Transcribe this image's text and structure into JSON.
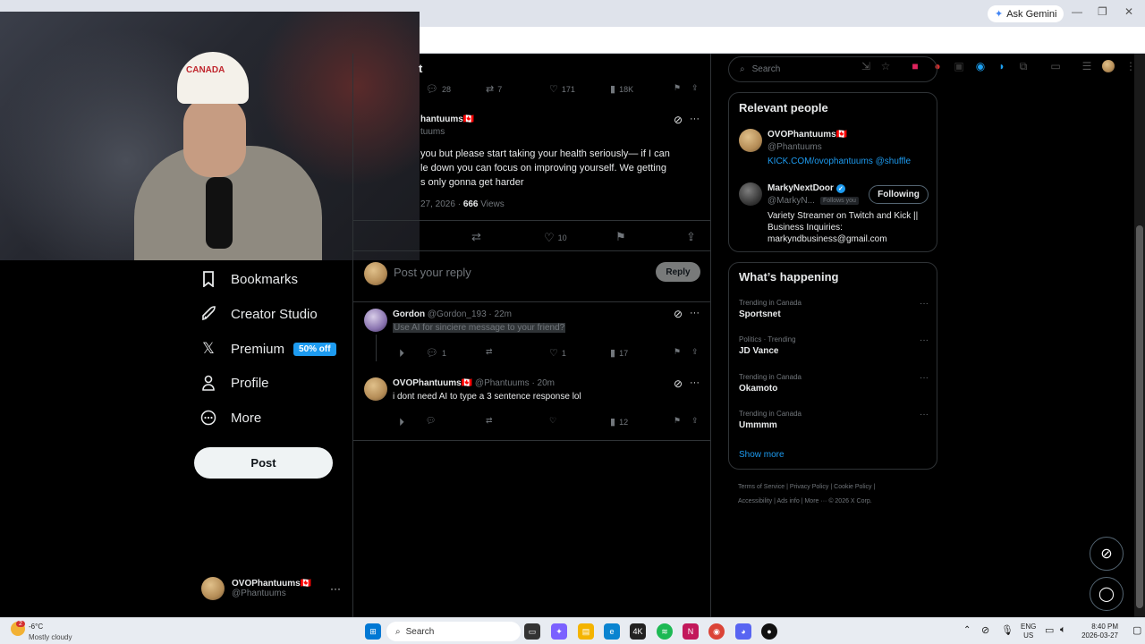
{
  "browser": {
    "ask_gemini": "Ask Gemini"
  },
  "webcam": {
    "hat_text": "CANADA"
  },
  "nav": {
    "bookmarks": "Bookmarks",
    "creator_studio": "Creator Studio",
    "premium": "Premium",
    "premium_badge": "50% off",
    "profile": "Profile",
    "more": "More",
    "post_button": "Post"
  },
  "account": {
    "name": "OVOPhantuums🇨🇦",
    "handle": "@Phantuums"
  },
  "prev_tweet": {
    "title_fragment": "t",
    "replies": "28",
    "retweets": "7",
    "likes": "171",
    "views": "18K"
  },
  "main_tweet": {
    "name_fragment": "hantuums🇨🇦",
    "handle_fragment": "tuums",
    "line1": "you but please start taking your health seriously— if I can",
    "line2": "le down you can focus on improving yourself. We getting",
    "line3": "s only gonna get harder",
    "date_fragment": "27, 2026 · ",
    "views_count": "666",
    "views_label": " Views",
    "likes": "10"
  },
  "reply_box": {
    "placeholder": "Post your reply",
    "button": "Reply"
  },
  "replies": [
    {
      "name": "Gordon",
      "meta": "@Gordon_193 · 22m",
      "text": "Use AI for sinciere message to your friend?",
      "replies": "1",
      "likes": "1",
      "views": "17"
    },
    {
      "name": "OVOPhantuums🇨🇦",
      "meta": "@Phantuums · 20m",
      "text": "i dont need AI to type a 3 sentence response lol",
      "views": "12"
    }
  ],
  "sidebar": {
    "search_placeholder": "Search",
    "relevant_title": "Relevant people",
    "people": [
      {
        "name": "OVOPhantuums🇨🇦",
        "handle": "@Phantuums",
        "bio": "KICK.COM/ovophantuums @shuffle"
      },
      {
        "name": "MarkyNextDoor",
        "handle": "@MarkyN...",
        "follows_you": "Follows you",
        "follow_button": "Following",
        "bio1": "Variety Streamer on Twitch and Kick ||",
        "bio2": "Business Inquiries:",
        "bio3": "markyndbusiness@gmail.com"
      }
    ],
    "happening_title": "What’s happening",
    "trends": [
      {
        "category": "Trending in Canada",
        "name": "Sportsnet"
      },
      {
        "category": "Politics · Trending",
        "name": "JD Vance"
      },
      {
        "category": "Trending in Canada",
        "name": "Okamoto"
      },
      {
        "category": "Trending in Canada",
        "name": "Ummmm"
      }
    ],
    "show_more": "Show more",
    "footer": {
      "terms": "Terms of Service",
      "privacy": "Privacy Policy",
      "cookie": "Cookie Policy",
      "accessibility": "Accessibility",
      "ads": "Ads info",
      "more": "More ···",
      "copyright": "© 2026 X Corp."
    }
  },
  "taskbar": {
    "weather_temp": "-6°C",
    "weather_desc": "Mostly cloudy",
    "weather_badge": "2",
    "search": "Search",
    "lang1": "ENG",
    "lang2": "US",
    "time": "8:40 PM",
    "date": "2026-03-27"
  },
  "colors": {
    "accent": "#1d9bf0",
    "background": "#000000",
    "border": "#2f3336",
    "muted": "#71767b"
  }
}
